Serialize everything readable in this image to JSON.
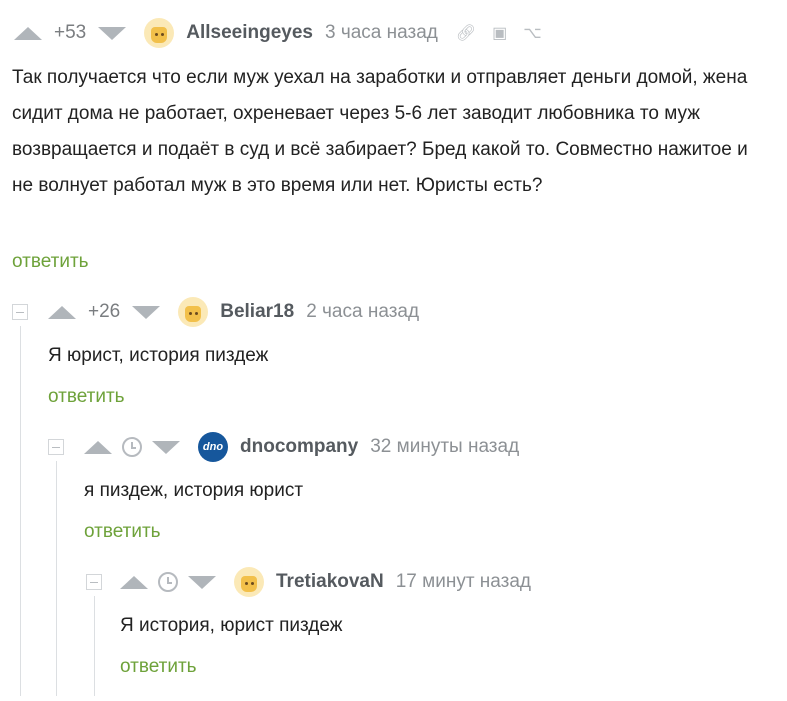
{
  "comments": [
    {
      "score": "+53",
      "username": "Allseeingeyes",
      "time": "3 часа назад",
      "text": "Так получается что если муж уехал на заработки и отправляет деньги домой, жена сидит дома не работает, охреневает через 5-6 лет заводит любовника то муж возвращается и подаёт в суд и всё забирает?  Бред какой то. Совместно нажитое и не волнует работал муж в это время или нет.  Юристы есть?",
      "reply": "ответить",
      "avatar_icon": "avatar-smiley-icon"
    },
    {
      "score": "+26",
      "username": "Beliar18",
      "time": "2 часа назад",
      "text": "Я юрист, история пиздеж",
      "reply": "ответить",
      "avatar_icon": "avatar-smiley-icon"
    },
    {
      "username": "dnocompany",
      "time": "32 минуты назад",
      "text": "я пиздеж, история юрист",
      "reply": "ответить",
      "avatar_label": "dno"
    },
    {
      "username": "TretiakovaN",
      "time": "17 минут назад",
      "text": "Я история, юрист пиздеж",
      "reply": "ответить",
      "avatar_icon": "avatar-smiley-icon"
    }
  ],
  "colors": {
    "reply_link": "#6ea23a",
    "icon_gray": "#b0b5ba",
    "dno_avatar_bg": "#16579c"
  }
}
